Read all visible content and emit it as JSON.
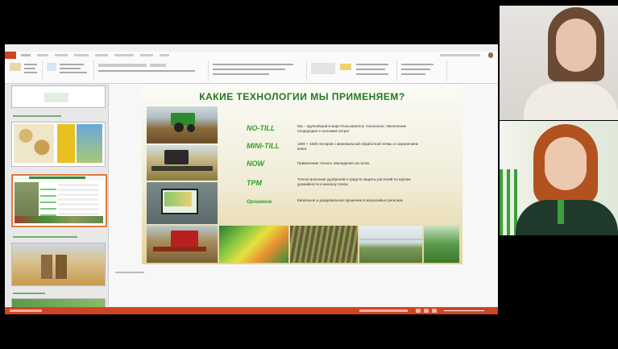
{
  "slide": {
    "title": "КАКИЕ ТЕХНОЛОГИИ МЫ ПРИМЕНЯЕМ?",
    "technologies": [
      {
        "name": "NO-TILL",
        "desc": "Мы – крупнейший в мире Пользователь технологии. Увеличение плодородия и экономия затрат"
      },
      {
        "name": "MINI-TILL",
        "desc": "1000 + 1000 гектаров с минимальной обработкой почвы и сохранением влаги"
      },
      {
        "name": "NOW",
        "desc": "Применение точного земледелия на полях"
      },
      {
        "name": "TPM",
        "desc": "Точное внесение удобрений и средств защиты растений по картам урожайности и анализу почвы"
      },
      {
        "name": "Орошение",
        "desc": "Капельное и дождевальное орошение в засушливых регионах"
      }
    ]
  },
  "colors": {
    "accent": "#d04423",
    "slide_title": "#1f7a1f",
    "tech_label": "#2fa02f",
    "selected_slide": "#e07a3f"
  }
}
